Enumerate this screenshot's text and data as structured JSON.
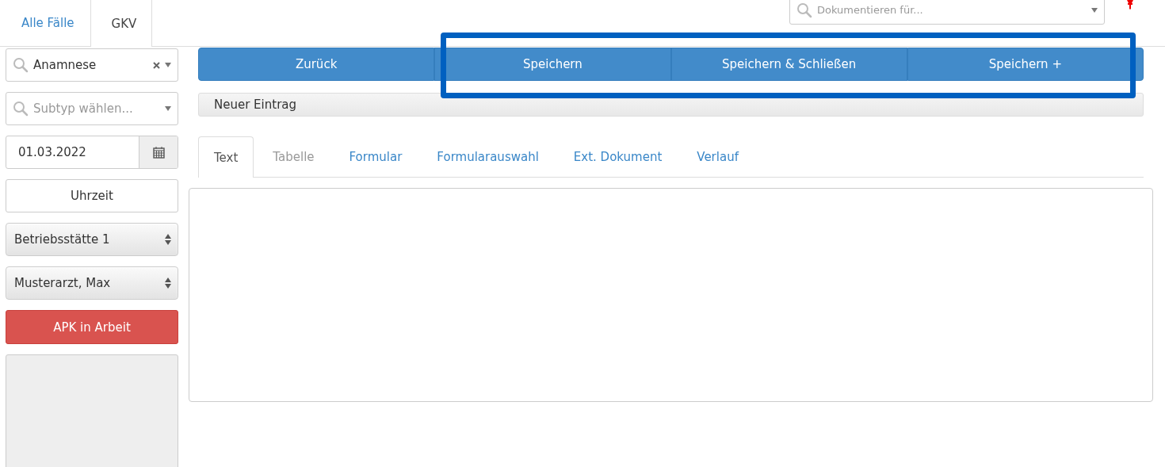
{
  "top_tabs": [
    {
      "label": "Alle Fälle",
      "selected": false
    },
    {
      "label": "GKV",
      "selected": true
    }
  ],
  "documenting_search": {
    "placeholder": "Dokumentieren für..."
  },
  "sidebar": {
    "type_select": {
      "value": "Anamnese"
    },
    "subtype_select": {
      "placeholder": "Subtyp wählen..."
    },
    "date_field": {
      "value": "01.03.2022"
    },
    "time_button": "Uhrzeit",
    "selects": [
      {
        "value": "Betriebsstätte 1"
      },
      {
        "value": "Musterarzt, Max"
      }
    ],
    "status_button": "APK in Arbeit"
  },
  "actions": [
    {
      "label": "Zurück"
    },
    {
      "label": "Speichern"
    },
    {
      "label": "Speichern & Schließen"
    },
    {
      "label": "Speichern +"
    }
  ],
  "annotation": {
    "kind": "frame"
  },
  "entry_bar": "Neuer Eintrag",
  "content_tabs": [
    {
      "label": "Text",
      "selected": true,
      "disabled": false
    },
    {
      "label": "Tabelle",
      "selected": false,
      "disabled": true
    },
    {
      "label": "Formular",
      "selected": false,
      "disabled": false
    },
    {
      "label": "Formularauswahl",
      "selected": false,
      "disabled": false
    },
    {
      "label": "Ext. Dokument",
      "selected": false,
      "disabled": false
    },
    {
      "label": "Verlauf",
      "selected": false,
      "disabled": false
    }
  ]
}
